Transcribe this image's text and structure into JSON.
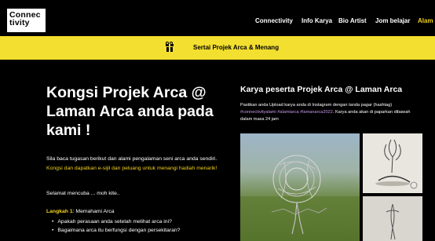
{
  "header": {
    "logo_line1": "Connec",
    "logo_line2": "tivity",
    "nav": [
      {
        "label": "Connectivity"
      },
      {
        "label": "Info Karya"
      },
      {
        "label": "Bio Artist"
      },
      {
        "label": "Jom belajar"
      },
      {
        "label": "Alam"
      }
    ],
    "active_color": "#f2d21b"
  },
  "banner": {
    "icon": "gift-icon",
    "text": "Sertai Projek Arca & Menang",
    "background": "#f3df2f"
  },
  "hero": {
    "title": "Kongsi Projek Arca @ Laman Arca anda pada kami !",
    "intro_plain": "Sila baca tugasan berikut dan alami pengalaman seni arca anda sendiri. ",
    "intro_highlight": "Kongsi dan dapatkan e-sijil dan peluang untuk menangi hadiah menarik!",
    "greeting": "Selamat mencuba ... moh kite..",
    "step_label": "Langkah 1",
    "step_text": ": Memahami Arca",
    "bullets": [
      "Apakah perasaan anda setelah melihat arca ini?",
      "Bagaimana arca itu berfungsi dengan persekitaran?"
    ]
  },
  "gallery": {
    "title": "Karya peserta Projek Arca @ Laman Arca",
    "desc_plain": "Pastikan anda Upload karya anda di Instagram dengan tanda pagar (hashtag) ",
    "desc_tags": "#connectivityalami #alamiarca #lamanarca2022",
    "desc_tail": ". Karya anda akan di paparkan dibawah dalam masa 24 jam"
  }
}
